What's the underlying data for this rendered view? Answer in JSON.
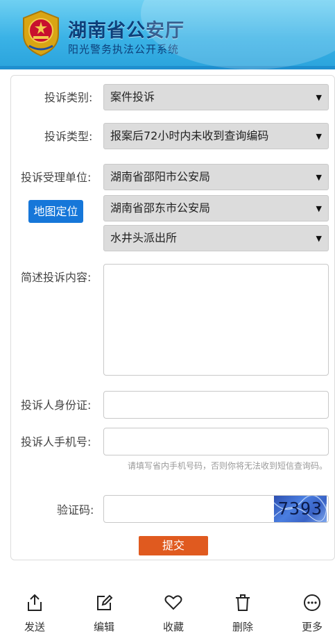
{
  "header": {
    "title": "湖南省公安厅",
    "subtitle": "阳光警务执法公开系统"
  },
  "form": {
    "complaint_category": {
      "label": "投诉类别:",
      "selected": "案件投诉"
    },
    "complaint_type": {
      "label": "投诉类型:",
      "selected": "报案后72小时内未收到查询编码"
    },
    "handling_unit": {
      "label": "投诉受理单位:",
      "map_button": "地图定位",
      "level1": "湖南省邵阳市公安局",
      "level2": "湖南省邵东市公安局",
      "level3": "水井头派出所"
    },
    "content": {
      "label": "简述投诉内容:",
      "value": ""
    },
    "id_card": {
      "label": "投诉人身份证:",
      "value": ""
    },
    "phone": {
      "label": "投诉人手机号:",
      "value": "",
      "hint": "请填写省内手机号码，否则你将无法收到短信查询码。"
    },
    "captcha": {
      "label": "验证码:",
      "value": "",
      "image_text": "7393"
    },
    "submit_label": "提交"
  },
  "toolbar": {
    "send": "发送",
    "edit": "编辑",
    "favorite": "收藏",
    "delete": "删除",
    "more": "更多"
  }
}
